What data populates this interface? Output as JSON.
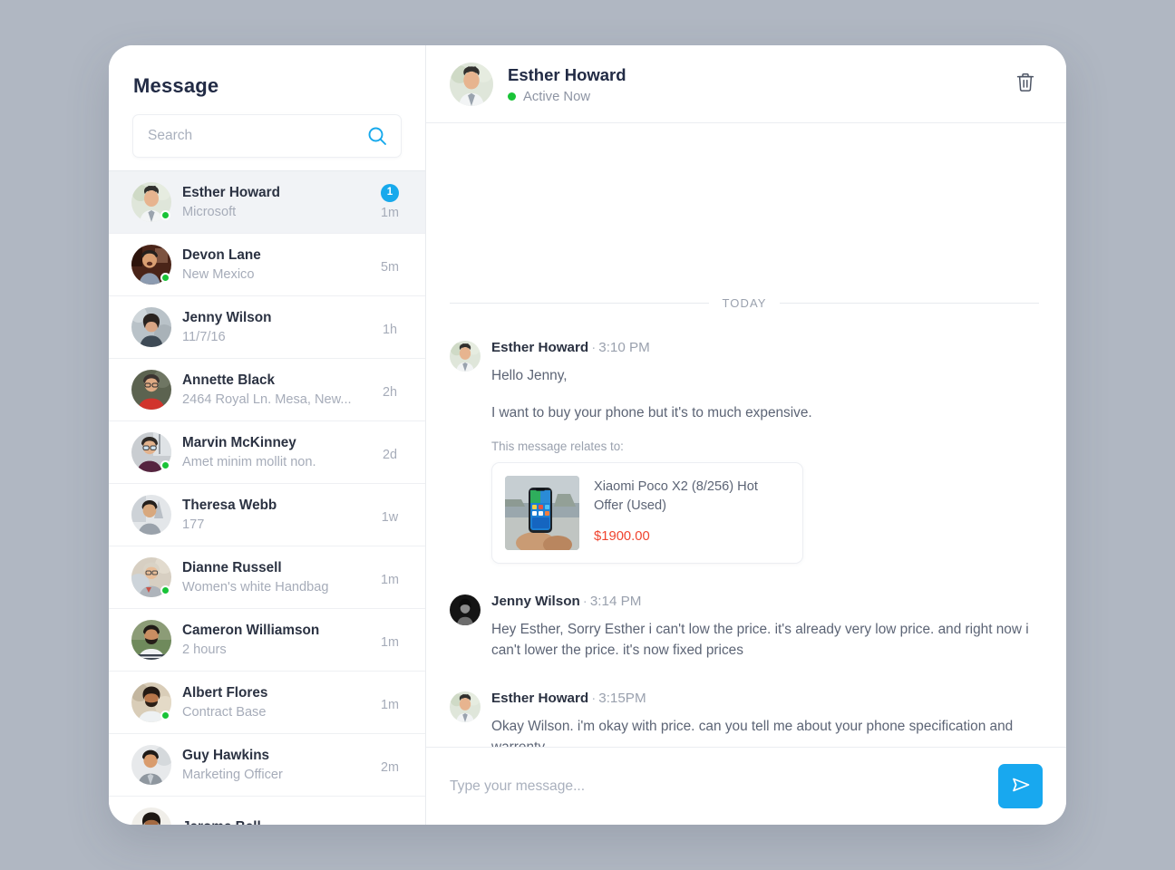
{
  "sidebar": {
    "title": "Message",
    "search": {
      "placeholder": "Search",
      "value": "",
      "icon": "search-icon"
    },
    "conversations": [
      {
        "name": "Esther Howard",
        "subtitle": "Microsoft",
        "time": "1m",
        "unread": "1",
        "online": true,
        "active": true,
        "avatar_kind": "esther"
      },
      {
        "name": "Devon Lane",
        "subtitle": "New Mexico",
        "time": "5m",
        "unread": "",
        "online": true,
        "active": false,
        "avatar_kind": "devon"
      },
      {
        "name": "Jenny Wilson",
        "subtitle": "11/7/16",
        "time": "1h",
        "unread": "",
        "online": false,
        "active": false,
        "avatar_kind": "jenny_list"
      },
      {
        "name": "Annette Black",
        "subtitle": "2464 Royal Ln. Mesa, New...",
        "time": "2h",
        "unread": "",
        "online": false,
        "active": false,
        "avatar_kind": "annette"
      },
      {
        "name": "Marvin McKinney",
        "subtitle": "Amet minim mollit non.",
        "time": "2d",
        "unread": "",
        "online": true,
        "active": false,
        "avatar_kind": "marvin"
      },
      {
        "name": "Theresa Webb",
        "subtitle": "177",
        "time": "1w",
        "unread": "",
        "online": false,
        "active": false,
        "avatar_kind": "theresa"
      },
      {
        "name": "Dianne Russell",
        "subtitle": "Women's white Handbag",
        "time": "1m",
        "unread": "",
        "online": true,
        "active": false,
        "avatar_kind": "dianne"
      },
      {
        "name": "Cameron Williamson",
        "subtitle": "2 hours",
        "time": "1m",
        "unread": "",
        "online": false,
        "active": false,
        "avatar_kind": "cameron"
      },
      {
        "name": "Albert Flores",
        "subtitle": "Contract Base",
        "time": "1m",
        "unread": "",
        "online": true,
        "active": false,
        "avatar_kind": "albert"
      },
      {
        "name": "Guy Hawkins",
        "subtitle": "Marketing Officer",
        "time": "2m",
        "unread": "",
        "online": false,
        "active": false,
        "avatar_kind": "guy"
      },
      {
        "name": "Jerome Bell",
        "subtitle": "",
        "time": "",
        "unread": "",
        "online": false,
        "active": false,
        "avatar_kind": "jerome"
      }
    ]
  },
  "chat": {
    "header": {
      "peer_name": "Esther Howard",
      "status": "Active Now",
      "status_color": "#19c337",
      "delete_icon": "trash-icon"
    },
    "day_divider": "TODAY",
    "messages": [
      {
        "author": "Esther Howard",
        "separator": "·",
        "time": "3:10 PM",
        "avatar_kind": "esther",
        "lines": [
          "Hello Jenny,",
          "I want to buy your phone but it's to much expensive."
        ],
        "attachment": {
          "label": "This message relates to:",
          "title": "Xiaomi Poco X2 (8/256) Hot Offer (Used)",
          "price": "$1900.00",
          "price_color": "#f0442f"
        }
      },
      {
        "author": "Jenny Wilson",
        "separator": "·",
        "time": "3:14 PM",
        "avatar_kind": "jenny_msg",
        "lines": [
          "Hey Esther, Sorry Esther i can't low the price. it's already very low price. and right now i can't lower the price. it's now fixed prices"
        ],
        "attachment": null
      },
      {
        "author": "Esther Howard",
        "separator": "·",
        "time": "3:15PM",
        "avatar_kind": "esther",
        "lines": [
          "Okay Wilson. i'm okay with price. can you tell me about your phone specification and warrenty"
        ],
        "attachment": null
      }
    ],
    "composer": {
      "placeholder": "Type your message...",
      "value": "",
      "send_icon": "send-icon",
      "send_color": "#18a8ef"
    }
  },
  "theme": {
    "page_background": "#b0b7c2",
    "card_background": "#ffffff",
    "accent": "#18a8ef",
    "online": "#19c337",
    "price": "#f0442f",
    "active_row": "#f1f3f6"
  }
}
